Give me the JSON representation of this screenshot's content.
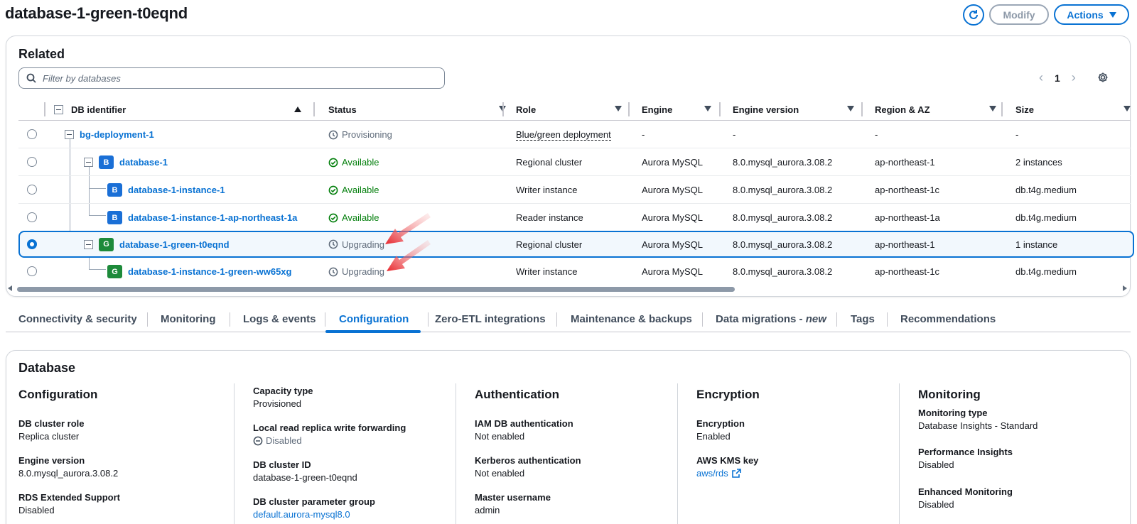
{
  "header": {
    "title": "database-1-green-t0eqnd",
    "modify_label": "Modify",
    "actions_label": "Actions"
  },
  "related": {
    "title": "Related",
    "filter_placeholder": "Filter by databases",
    "page": "1",
    "columns": [
      "DB identifier",
      "Status",
      "Role",
      "Engine",
      "Engine version",
      "Region & AZ",
      "Size"
    ],
    "rows": [
      {
        "id": "bg-deployment-1",
        "badge": "",
        "status": "Provisioning",
        "role": "Blue/green deployment",
        "engine": "-",
        "version": "-",
        "region": "-",
        "size": "-"
      },
      {
        "id": "database-1",
        "badge": "B",
        "status": "Available",
        "role": "Regional cluster",
        "engine": "Aurora MySQL",
        "version": "8.0.mysql_aurora.3.08.2",
        "region": "ap-northeast-1",
        "size": "2 instances"
      },
      {
        "id": "database-1-instance-1",
        "badge": "B",
        "status": "Available",
        "role": "Writer instance",
        "engine": "Aurora MySQL",
        "version": "8.0.mysql_aurora.3.08.2",
        "region": "ap-northeast-1c",
        "size": "db.t4g.medium"
      },
      {
        "id": "database-1-instance-1-ap-northeast-1a",
        "badge": "B",
        "status": "Available",
        "role": "Reader instance",
        "engine": "Aurora MySQL",
        "version": "8.0.mysql_aurora.3.08.2",
        "region": "ap-northeast-1a",
        "size": "db.t4g.medium"
      },
      {
        "id": "database-1-green-t0eqnd",
        "badge": "G",
        "status": "Upgrading",
        "role": "Regional cluster",
        "engine": "Aurora MySQL",
        "version": "8.0.mysql_aurora.3.08.2",
        "region": "ap-northeast-1",
        "size": "1 instance"
      },
      {
        "id": "database-1-instance-1-green-ww65xg",
        "badge": "G",
        "status": "Upgrading",
        "role": "Writer instance",
        "engine": "Aurora MySQL",
        "version": "8.0.mysql_aurora.3.08.2",
        "region": "ap-northeast-1c",
        "size": "db.t4g.medium"
      }
    ]
  },
  "tabs": {
    "items": [
      "Connectivity & security",
      "Monitoring",
      "Logs & events",
      "Configuration",
      "Zero-ETL integrations",
      "Maintenance & backups",
      "Data migrations - ",
      "Tags",
      "Recommendations"
    ],
    "new_suffix": "new",
    "active": "Configuration"
  },
  "database": {
    "title": "Database",
    "configuration": {
      "heading": "Configuration",
      "cluster_role_k": "DB cluster role",
      "cluster_role_v": "Replica cluster",
      "engine_version_k": "Engine version",
      "engine_version_v": "8.0.mysql_aurora.3.08.2",
      "extended_support_k": "RDS Extended Support",
      "extended_support_v": "Disabled"
    },
    "capacity": {
      "capacity_type_k": "Capacity type",
      "capacity_type_v": "Provisioned",
      "write_fwd_k": "Local read replica write forwarding",
      "write_fwd_v": "Disabled",
      "cluster_id_k": "DB cluster ID",
      "cluster_id_v": "database-1-green-t0eqnd",
      "param_group_k": "DB cluster parameter group",
      "param_group_v": "default.aurora-mysql8.0"
    },
    "authentication": {
      "heading": "Authentication",
      "iam_k": "IAM DB authentication",
      "iam_v": "Not enabled",
      "kerberos_k": "Kerberos authentication",
      "kerberos_v": "Not enabled",
      "master_k": "Master username",
      "master_v": "admin"
    },
    "encryption": {
      "heading": "Encryption",
      "enc_k": "Encryption",
      "enc_v": "Enabled",
      "kms_k": "AWS KMS key",
      "kms_v": "aws/rds"
    },
    "monitoring": {
      "heading": "Monitoring",
      "type_k": "Monitoring type",
      "type_v": "Database Insights - Standard",
      "pi_k": "Performance Insights",
      "pi_v": "Disabled",
      "em_k": "Enhanced Monitoring",
      "em_v": "Disabled"
    }
  },
  "colors": {
    "accent": "#0972d3",
    "available": "#037f0c",
    "badge_blue": "#1a6fd6",
    "badge_green": "#1d8a3a",
    "arrow": "#e8262c"
  }
}
